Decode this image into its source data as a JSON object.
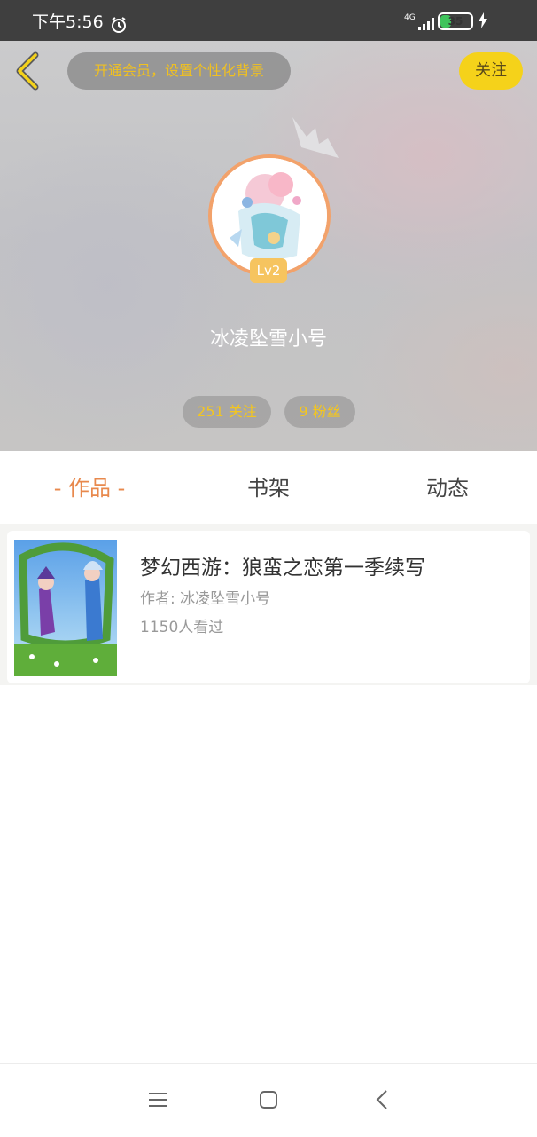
{
  "status_bar": {
    "time": "下午5:56",
    "network": "4G",
    "battery": "35",
    "battery_level": 0.35,
    "battery_color": "#3fc45c"
  },
  "header": {
    "vip_prompt": "开通会员，设置个性化背景",
    "follow_button": "关注",
    "level": "Lv2",
    "username": "冰凌坠雪小号",
    "stats": {
      "following": "251 关注",
      "fans": "9 粉丝"
    },
    "accent_color": "#f5d21a"
  },
  "tabs": [
    {
      "label": "- 作品 -",
      "active": true
    },
    {
      "label": "书架",
      "active": false
    },
    {
      "label": "动态",
      "active": false
    }
  ],
  "works": [
    {
      "title": "梦幻西游：狼蛮之恋第一季续写",
      "author": "作者: 冰凌坠雪小号",
      "views": "1150人看过"
    }
  ],
  "nav": {
    "icons": [
      "menu-icon",
      "home-square-icon",
      "back-chevron-icon"
    ]
  }
}
